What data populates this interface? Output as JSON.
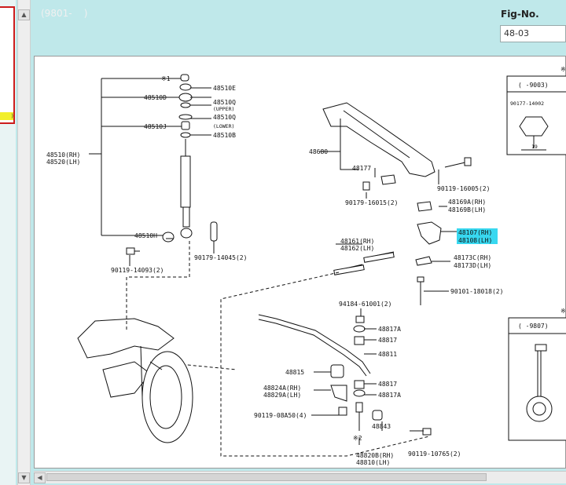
{
  "header": {
    "period": "(9801-    )",
    "fig_label": "Fig-No.",
    "fig_value": "48-03"
  },
  "left_list": {
    "selected_suffix": ")"
  },
  "labels": {
    "mark1": "※1",
    "p48510E": "48510E",
    "p48510D": "48510D",
    "p48510Q_upper": "48510Q",
    "upper": "(UPPER)",
    "p48510Q_lower": "48510Q",
    "lower": "(LOWER)",
    "p48510J": "48510J",
    "p48510B": "48510B",
    "p48510_rh": "48510(RH)",
    "p48520_lh": "48520(LH)",
    "p48510H": "48510H",
    "p90119_14093": "90119-14093(2)",
    "p90179_14045": "90179-14045(2)",
    "p48680": "48680",
    "p48177": "48177",
    "p90119_16005": "90119-16005(2)",
    "p90179_16015": "90179-16015(2)",
    "p48169A": "48169A(RH)",
    "p48169B": "48169B(LH)",
    "p48107": "48107(RH)",
    "p48108": "48108(LH)",
    "p48161": "48161(RH)",
    "p48162": "48162(LH)",
    "p48173C": "48173C(RH)",
    "p48173D": "48173D(LH)",
    "p90101_18018": "90101-18018(2)",
    "p94184_61001": "94184-61001(2)",
    "p48817A_top": "48817A",
    "p48817_top": "48817",
    "p48811": "48811",
    "p48815": "48815",
    "p48817_bot": "48817",
    "p48824A": "48824A(RH)",
    "p48829A": "48829A(LH)",
    "p48817A_bot": "48817A",
    "p90119_08a50": "90119-08A50(4)",
    "p48843": "48843",
    "mark2": "※2",
    "p48820B": "48820B(RH)",
    "p48810": "48810(LH)",
    "p90119_10765": "90119-10765(2)"
  },
  "inset_top": {
    "corner_mark": "※",
    "period": "(    -9003)",
    "part": "90177-14002",
    "dim": "19"
  },
  "inset_bottom": {
    "corner_mark": "※",
    "period": "(    -9807)"
  },
  "colors": {
    "highlight": "#38d8f0",
    "selected_row": "#f2ef2a",
    "list_border": "#cc1c1c"
  },
  "icons": {
    "scroll_up": "triangle-up-icon",
    "scroll_down": "triangle-down-icon",
    "scroll_left": "triangle-left-icon"
  }
}
